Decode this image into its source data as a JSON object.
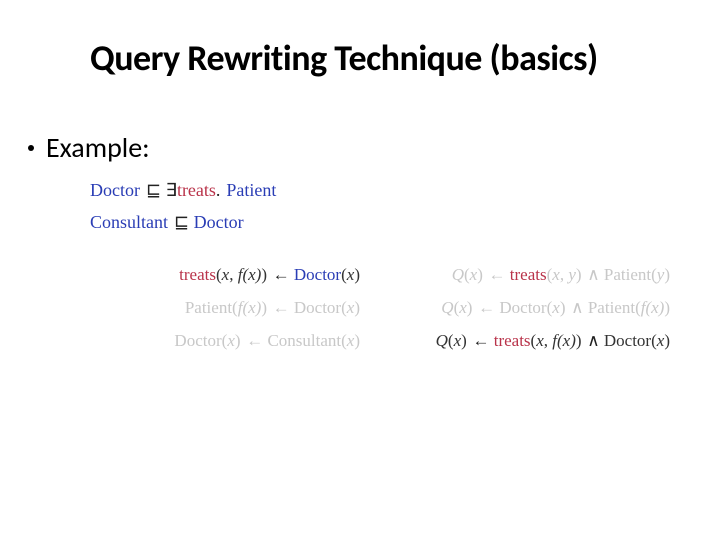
{
  "title": "Query Rewriting Technique (basics)",
  "bullet": "Example:",
  "kw": {
    "doctor": "Doctor",
    "consultant": "Consultant",
    "patient": "Patient",
    "treats": "treats"
  },
  "sym": {
    "sqsub": "⊑",
    "exists": "∃",
    "dot": ".",
    "larr": "←",
    "and": "∧"
  },
  "m": {
    "x": "x",
    "y": "y",
    "fx": "f(x)",
    "Q": "Q"
  },
  "p": {
    "op": "(",
    "cp": ")",
    "com": ", "
  }
}
